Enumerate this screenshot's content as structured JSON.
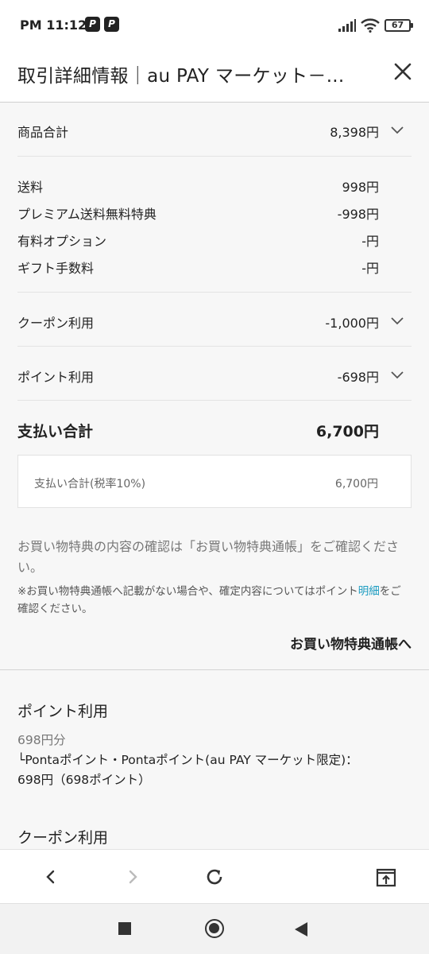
{
  "status": {
    "time": "PM 11:12",
    "app_icon_1": "paypay-icon",
    "app_icon_2": "paypay-icon",
    "battery": "67"
  },
  "header": {
    "title": "取引詳細情報｜au PAY マーケット－...",
    "close_icon": "close-icon"
  },
  "summary": {
    "subtotal_label": "商品合計",
    "subtotal_value": "8,398円",
    "shipping_label": "送料",
    "shipping_value": "998円",
    "premium_label": "プレミアム送料無料特典",
    "premium_value": "-998円",
    "option_label": "有料オプション",
    "option_value": "-円",
    "gift_label": "ギフト手数料",
    "gift_value": "-円",
    "coupon_label": "クーポン利用",
    "coupon_value": "-1,000円",
    "point_label": "ポイント利用",
    "point_value": "-698円",
    "total_label": "支払い合計",
    "total_value": "6,700円",
    "tax_label": "支払い合計(税率10%)",
    "tax_value": "6,700円"
  },
  "notice": {
    "main": "お買い物特典の内容の確認は「お買い物特典通帳」をご確認ください。",
    "small_before": "※お買い物特典通帳へ記載がない場合や、確定内容についてはポイント",
    "small_link": "明細",
    "small_after": "をご確認ください。",
    "small_link_prefix": "ポイント",
    "passbook_link": "お買い物特典通帳へ"
  },
  "points_section": {
    "title": "ポイント利用",
    "amount": "698円分",
    "detail_line1": "└Pontaポイント・Pontaポイント(au PAY マーケット限定)：",
    "detail_line2": "698円（698ポイント）"
  },
  "coupon_section": {
    "title": "クーポン利用"
  },
  "browser": {
    "back_icon": "back-icon",
    "forward_icon": "forward-icon",
    "reload_icon": "reload-icon",
    "open_external_icon": "open-external-icon"
  },
  "colors": {
    "link": "#1a9bc0",
    "background": "#f7f7f7"
  }
}
